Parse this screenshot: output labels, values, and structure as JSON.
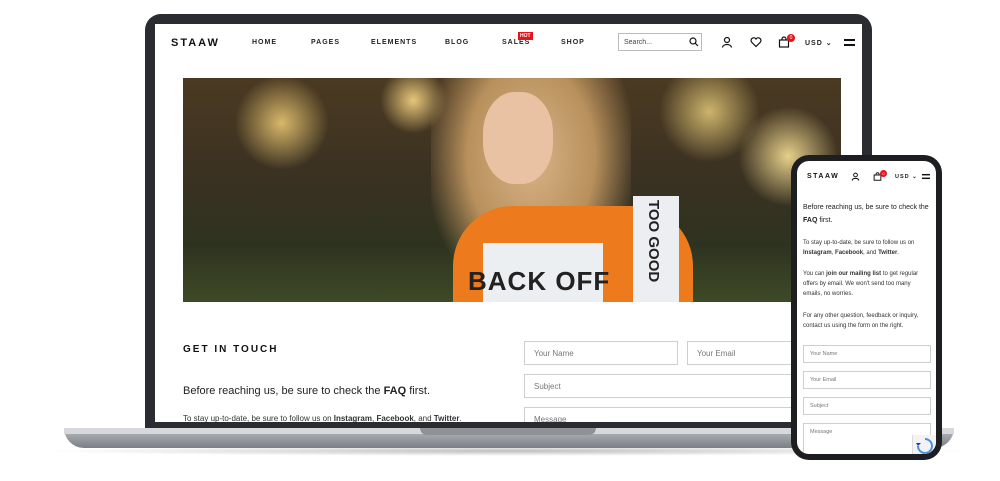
{
  "brand": "STAAW",
  "nav": [
    "HOME",
    "PAGES",
    "ELEMENTS",
    "BLOG",
    "SALES",
    "SHOP"
  ],
  "hot_label": "HOT",
  "search_placeholder": "Search...",
  "cart_count": "0",
  "currency": "USD",
  "hero_hoodie_text": "BACK OFF",
  "hero_sleeve_text": "TOO GOOD",
  "contact": {
    "heading": "GET IN TOUCH",
    "before": "Before reaching us, be sure to check the ",
    "faq": "FAQ",
    "first": " first.",
    "stay_prefix": "To stay up-to-date, be sure to follow us on ",
    "instagram": "Instagram",
    "facebook": "Facebook",
    "and": ", and ",
    "twitter": "Twitter",
    "fields": {
      "name": "Your Name",
      "email": "Your Email",
      "subject": "Subject",
      "message": "Message"
    }
  },
  "mobile": {
    "mailing_prefix": "You can ",
    "mailing_link": "join our mailing list",
    "mailing_suffix": " to get regular offers by email. We won't send too many emails, no worries.",
    "other": "For any other question, feedback or inquiry, contact us using the form on the right."
  }
}
